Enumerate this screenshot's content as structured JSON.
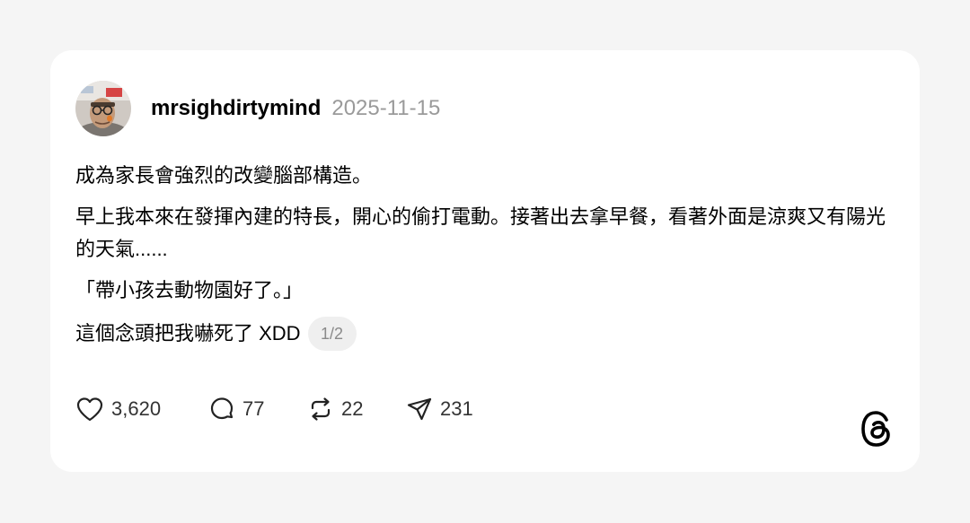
{
  "post": {
    "username": "mrsighdirtymind",
    "date": "2025-11-15",
    "paragraphs": [
      "成為家長會強烈的改變腦部構造。",
      "早上我本來在發揮內建的特長，開心的偷打電動。接著出去拿早餐，看著外面是涼爽又有陽光的天氣......",
      "「帶小孩去動物園好了。」"
    ],
    "last_line": "這個念頭把我嚇死了 XDD",
    "page_badge": "1/2"
  },
  "actions": {
    "likes": "3,620",
    "comments": "77",
    "reposts": "22",
    "shares": "231"
  },
  "icons": {
    "like": "heart-icon",
    "comment": "speech-bubble-icon",
    "repost": "repost-icon",
    "share": "paper-plane-icon",
    "brand": "threads-logo-icon"
  },
  "colors": {
    "background": "#f5f5f5",
    "card": "#ffffff",
    "date": "#9a9a9a",
    "badge_bg": "#efefef"
  }
}
